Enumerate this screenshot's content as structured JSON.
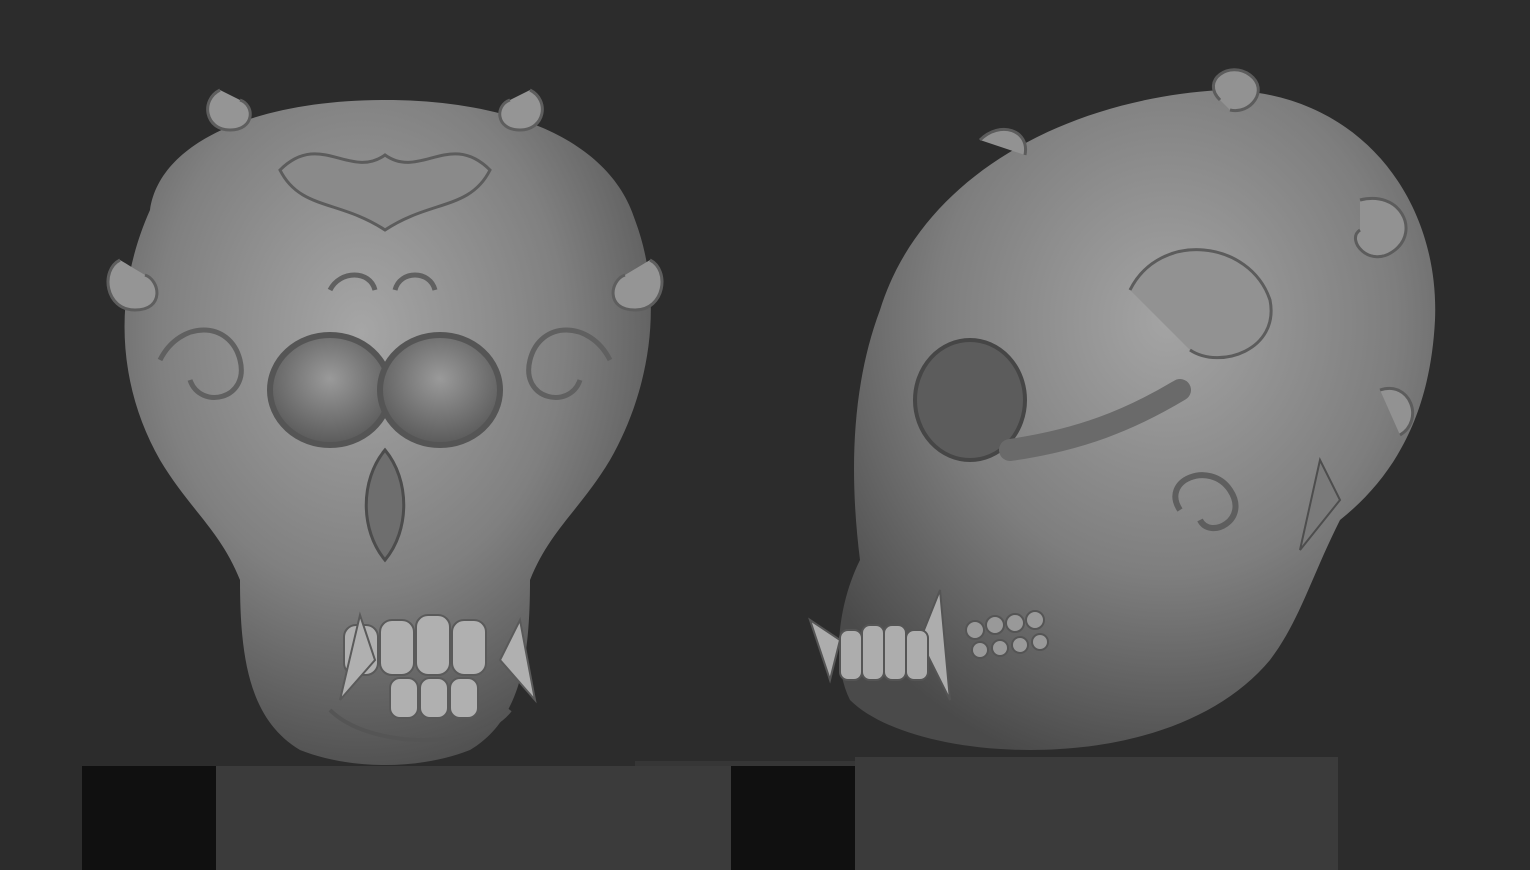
{
  "scene": {
    "background_color": "#2c2c2c",
    "views": [
      {
        "view": "front",
        "material_color": "#8e8e8e",
        "icon": "skull-front-icon"
      },
      {
        "view": "side",
        "material_color": "#8e8e8e",
        "icon": "skull-side-icon"
      }
    ],
    "pedestal_colors": {
      "dark": "#101010",
      "light": "#3b3b3b"
    }
  }
}
